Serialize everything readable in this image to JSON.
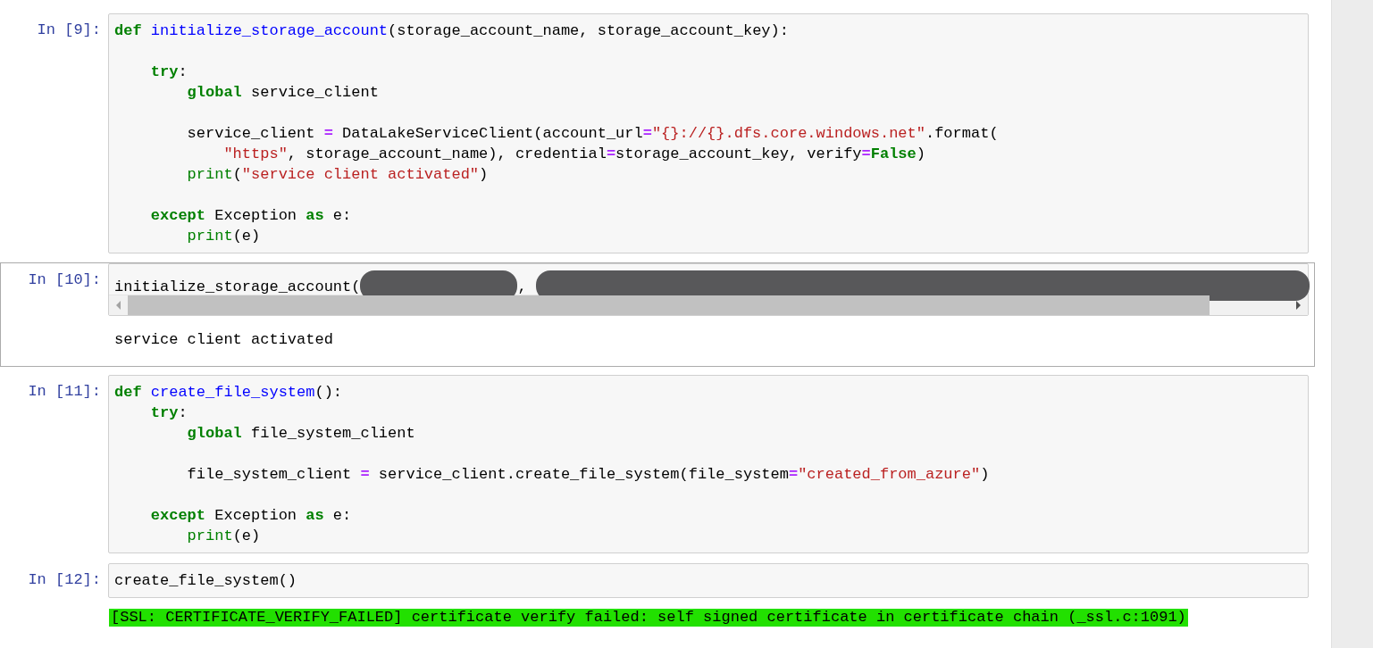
{
  "cells": [
    {
      "prompt": "In [9]:",
      "selected": false,
      "scrollbar": false,
      "lines": [
        {
          "kind": "code",
          "tokens": [
            {
              "kind": "kw",
              "text": "def"
            },
            {
              "kind": "fn",
              "text": " initialize_storage_account"
            },
            {
              "kind": "plain",
              "text": "(storage_account_name, storage_account_key):"
            }
          ]
        },
        {
          "kind": "blank"
        },
        {
          "kind": "code",
          "tokens": [
            {
              "kind": "kw",
              "text": "    try"
            },
            {
              "kind": "plain",
              "text": ":"
            }
          ]
        },
        {
          "kind": "code",
          "tokens": [
            {
              "kind": "kw",
              "text": "        global"
            },
            {
              "kind": "plain",
              "text": " service_client"
            }
          ]
        },
        {
          "kind": "blank"
        },
        {
          "kind": "code",
          "tokens": [
            {
              "kind": "plain",
              "text": "        service_client "
            },
            {
              "kind": "op",
              "text": "="
            },
            {
              "kind": "plain",
              "text": " DataLakeServiceClient(account_url"
            },
            {
              "kind": "op",
              "text": "="
            },
            {
              "kind": "str",
              "text": "\"{}://{}.dfs.core.windows.net\""
            },
            {
              "kind": "plain",
              "text": ".format("
            }
          ]
        },
        {
          "kind": "code",
          "tokens": [
            {
              "kind": "str",
              "text": "            \"https\""
            },
            {
              "kind": "plain",
              "text": ", storage_account_name), credential"
            },
            {
              "kind": "op",
              "text": "="
            },
            {
              "kind": "plain",
              "text": "storage_account_key, verify"
            },
            {
              "kind": "op",
              "text": "="
            },
            {
              "kind": "kw",
              "text": "False"
            },
            {
              "kind": "plain",
              "text": ")"
            }
          ]
        },
        {
          "kind": "code",
          "tokens": [
            {
              "kind": "builtin",
              "text": "        print"
            },
            {
              "kind": "plain",
              "text": "("
            },
            {
              "kind": "str",
              "text": "\"service client activated\""
            },
            {
              "kind": "plain",
              "text": ")"
            }
          ]
        },
        {
          "kind": "blank"
        },
        {
          "kind": "code",
          "tokens": [
            {
              "kind": "kw",
              "text": "    except"
            },
            {
              "kind": "plain",
              "text": " Exception "
            },
            {
              "kind": "kw",
              "text": "as"
            },
            {
              "kind": "plain",
              "text": " e:"
            }
          ]
        },
        {
          "kind": "code",
          "tokens": [
            {
              "kind": "builtin",
              "text": "        print"
            },
            {
              "kind": "plain",
              "text": "(e)"
            }
          ]
        }
      ]
    },
    {
      "prompt": "In [10]:",
      "selected": true,
      "scrollbar": true,
      "lines": [
        {
          "kind": "code",
          "tokens": [
            {
              "kind": "plain",
              "text": "initialize_storage_account("
            },
            {
              "kind": "redaction"
            },
            {
              "kind": "plain",
              "text": ", "
            },
            {
              "kind": "redaction"
            }
          ]
        }
      ],
      "output": {
        "text": "service client activated",
        "highlighted": false
      }
    },
    {
      "prompt": "In [11]:",
      "selected": false,
      "scrollbar": false,
      "lines": [
        {
          "kind": "code",
          "tokens": [
            {
              "kind": "kw",
              "text": "def"
            },
            {
              "kind": "fn",
              "text": " create_file_system"
            },
            {
              "kind": "plain",
              "text": "():"
            }
          ]
        },
        {
          "kind": "code",
          "tokens": [
            {
              "kind": "kw",
              "text": "    try"
            },
            {
              "kind": "plain",
              "text": ":"
            }
          ]
        },
        {
          "kind": "code",
          "tokens": [
            {
              "kind": "kw",
              "text": "        global"
            },
            {
              "kind": "plain",
              "text": " file_system_client"
            }
          ]
        },
        {
          "kind": "blank"
        },
        {
          "kind": "code",
          "tokens": [
            {
              "kind": "plain",
              "text": "        file_system_client "
            },
            {
              "kind": "op",
              "text": "="
            },
            {
              "kind": "plain",
              "text": " service_client.create_file_system(file_system"
            },
            {
              "kind": "op",
              "text": "="
            },
            {
              "kind": "str",
              "text": "\"created_from_azure\""
            },
            {
              "kind": "plain",
              "text": ")"
            }
          ]
        },
        {
          "kind": "blank"
        },
        {
          "kind": "code",
          "tokens": [
            {
              "kind": "kw",
              "text": "    except"
            },
            {
              "kind": "plain",
              "text": " Exception "
            },
            {
              "kind": "kw",
              "text": "as"
            },
            {
              "kind": "plain",
              "text": " e:"
            }
          ]
        },
        {
          "kind": "code",
          "tokens": [
            {
              "kind": "builtin",
              "text": "        print"
            },
            {
              "kind": "plain",
              "text": "(e)"
            }
          ]
        }
      ]
    },
    {
      "prompt": "In [12]:",
      "selected": false,
      "scrollbar": false,
      "lines": [
        {
          "kind": "code",
          "tokens": [
            {
              "kind": "plain",
              "text": "create_file_system()"
            }
          ]
        }
      ],
      "output": {
        "text": "[SSL: CERTIFICATE_VERIFY_FAILED] certificate verify failed: self signed certificate in certificate chain (_ssl.c:1091)",
        "highlighted": true
      }
    }
  ]
}
